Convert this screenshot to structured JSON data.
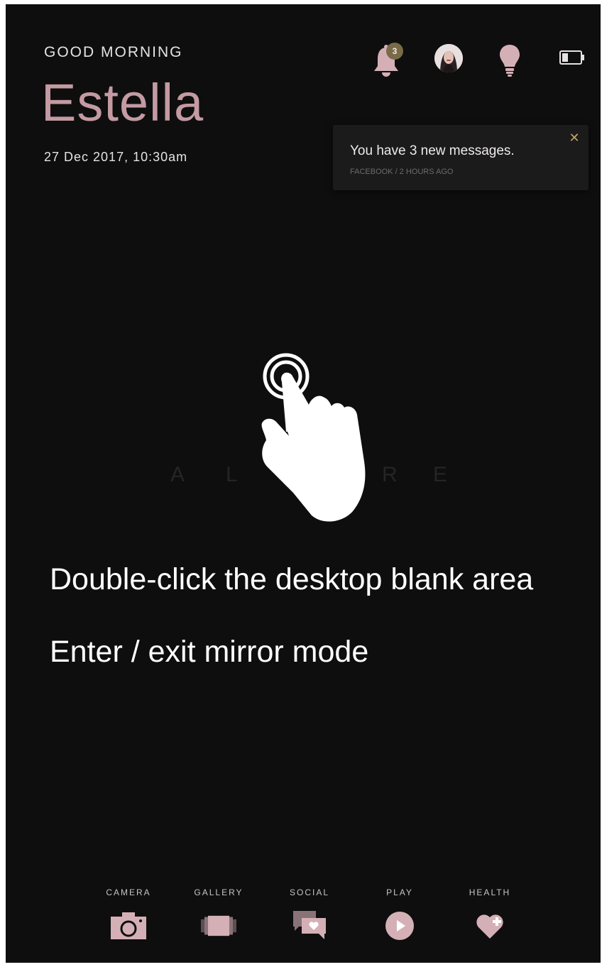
{
  "header": {
    "greeting": "GOOD MORNING",
    "user_name": "Estella",
    "datetime": "27 Dec 2017, 10:30am"
  },
  "status_bar": {
    "notification_count": "3",
    "icons": [
      "bell-icon",
      "avatar",
      "bulb-icon",
      "battery-icon"
    ],
    "battery_level": 0.35
  },
  "notification": {
    "title": "You have 3 new messages.",
    "meta": "FACEBOOK / 2 HOURS AGO",
    "close_label": "✕"
  },
  "watermark": {
    "letters": [
      "A",
      "L",
      "R",
      "E"
    ]
  },
  "instructions": {
    "line1": "Double-click the desktop blank area",
    "line2": "Enter / exit mirror mode"
  },
  "dock": {
    "items": [
      {
        "label": "CAMERA",
        "icon": "camera-icon"
      },
      {
        "label": "GALLERY",
        "icon": "gallery-icon"
      },
      {
        "label": "SOCIAL",
        "icon": "social-icon"
      },
      {
        "label": "PLAY",
        "icon": "play-icon"
      },
      {
        "label": "HEALTH",
        "icon": "health-icon"
      }
    ]
  },
  "colors": {
    "background": "#0e0e0e",
    "accent_pink": "#c49aa3",
    "icon_pink": "#d4b0b6",
    "badge": "#7a6a48",
    "close_gold": "#c9a062"
  }
}
